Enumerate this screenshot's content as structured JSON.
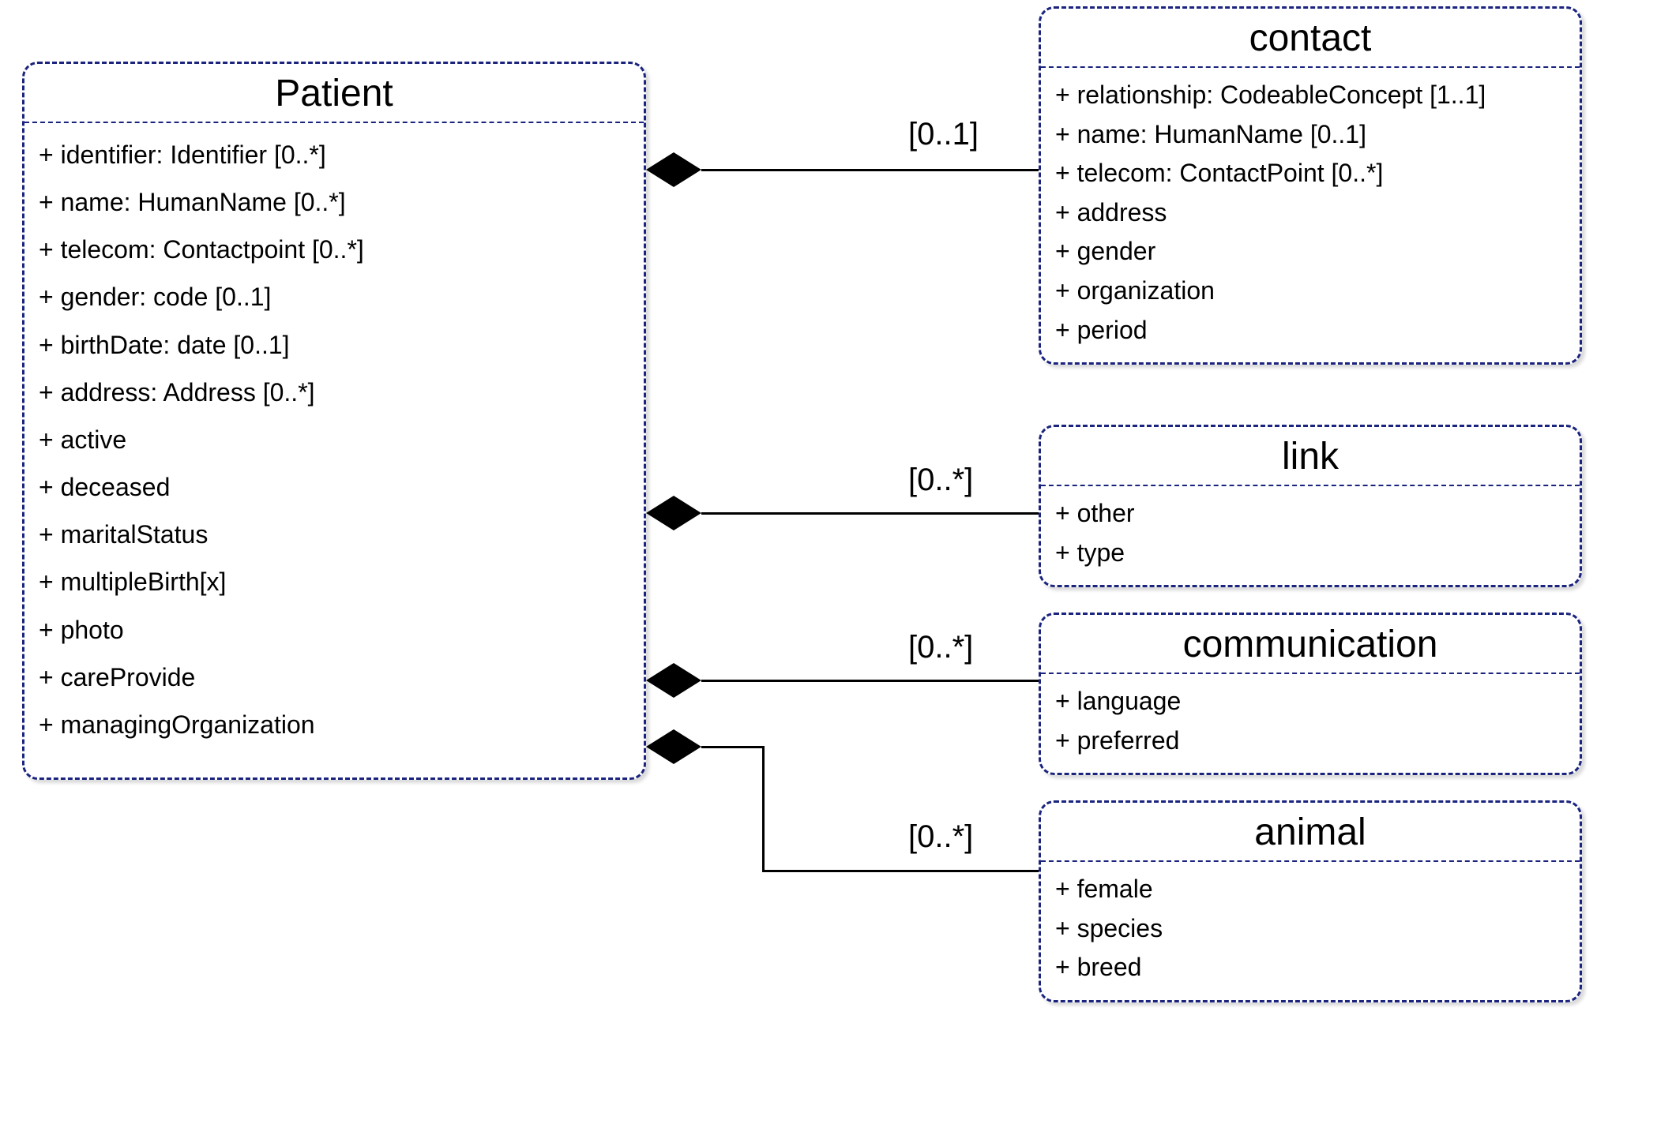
{
  "patient": {
    "title": "Patient",
    "attrs": [
      "+ identifier: Identifier [0..*]",
      "+ name: HumanName [0..*]",
      "+ telecom: Contactpoint [0..*]",
      "+ gender: code [0..1]",
      "+ birthDate: date [0..1]",
      "+ address: Address [0..*]",
      "+ active",
      "+ deceased",
      "+ maritalStatus",
      "+ multipleBirth[x]",
      "+ photo",
      "+ careProvide",
      "+ managingOrganization"
    ]
  },
  "contact": {
    "title": "contact",
    "cardinality": "[0..1]",
    "attrs": [
      "+ relationship: CodeableConcept [1..1]",
      "+ name: HumanName [0..1]",
      "+ telecom: ContactPoint [0..*]",
      "+ address",
      "+ gender",
      "+ organization",
      "+ period"
    ]
  },
  "link": {
    "title": "link",
    "cardinality": "[0..*]",
    "attrs": [
      "+ other",
      "+ type"
    ]
  },
  "communication": {
    "title": "communication",
    "cardinality": "[0..*]",
    "attrs": [
      "+ language",
      "+ preferred"
    ]
  },
  "animal": {
    "title": "animal",
    "cardinality": "[0..*]",
    "attrs": [
      "+ female",
      "+ species",
      "+ breed"
    ]
  }
}
